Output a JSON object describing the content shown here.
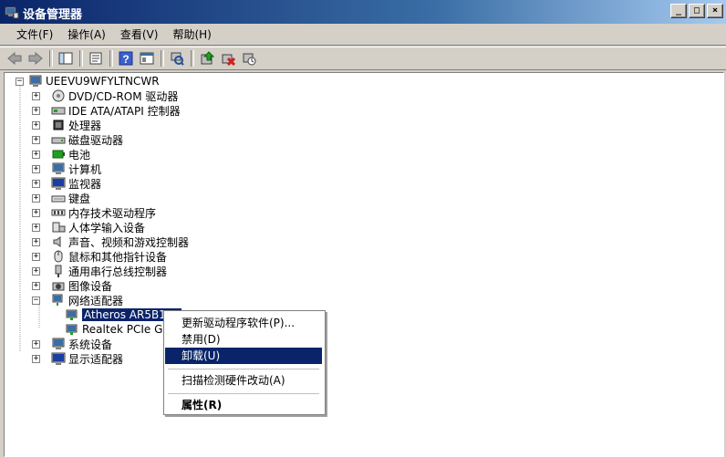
{
  "window": {
    "title": "设备管理器"
  },
  "menubar": [
    {
      "label": "文件(F)"
    },
    {
      "label": "操作(A)"
    },
    {
      "label": "查看(V)"
    },
    {
      "label": "帮助(H)"
    }
  ],
  "toolbar": [
    {
      "icon": "back-arrow-icon"
    },
    {
      "icon": "forward-arrow-icon"
    },
    {
      "icon": "show-hide-console-tree-icon"
    },
    {
      "icon": "properties-icon"
    },
    {
      "icon": "help-icon"
    },
    {
      "icon": "view-icon"
    },
    {
      "icon": "scan-hardware-icon"
    },
    {
      "icon": "update-driver-icon"
    },
    {
      "icon": "uninstall-icon"
    },
    {
      "icon": "disable-icon"
    }
  ],
  "tree": {
    "root": {
      "label": "UEEVU9WFYLTNCWR"
    },
    "items": [
      {
        "label": "DVD/CD-ROM 驱动器",
        "icon": "dvd-drive-icon"
      },
      {
        "label": "IDE ATA/ATAPI 控制器",
        "icon": "ide-controller-icon"
      },
      {
        "label": "处理器",
        "icon": "processor-icon"
      },
      {
        "label": "磁盘驱动器",
        "icon": "disk-drive-icon"
      },
      {
        "label": "电池",
        "icon": "battery-icon"
      },
      {
        "label": "计算机",
        "icon": "computer-icon"
      },
      {
        "label": "监视器",
        "icon": "monitor-icon"
      },
      {
        "label": "键盘",
        "icon": "keyboard-icon"
      },
      {
        "label": "内存技术驱动程序",
        "icon": "memory-icon"
      },
      {
        "label": "人体学输入设备",
        "icon": "hid-icon"
      },
      {
        "label": "声音、视频和游戏控制器",
        "icon": "sound-icon"
      },
      {
        "label": "鼠标和其他指针设备",
        "icon": "mouse-icon"
      },
      {
        "label": "通用串行总线控制器",
        "icon": "usb-icon"
      },
      {
        "label": "图像设备",
        "icon": "camera-icon"
      },
      {
        "label": "网络适配器",
        "icon": "network-adapter-icon"
      }
    ],
    "network_children": [
      {
        "label": "Atheros AR5B125",
        "selected": true
      },
      {
        "label": "Realtek PCIe GB"
      }
    ],
    "after_items": [
      {
        "label": "系统设备",
        "icon": "system-devices-icon"
      },
      {
        "label": "显示适配器",
        "icon": "display-adapter-icon"
      }
    ]
  },
  "context_menu": [
    {
      "label": "更新驱动程序软件(P)..."
    },
    {
      "label": "禁用(D)"
    },
    {
      "label": "卸载(U)",
      "highlighted": true
    },
    {
      "label": "扫描检测硬件改动(A)"
    },
    {
      "label": "属性(R)",
      "bold": true
    }
  ]
}
